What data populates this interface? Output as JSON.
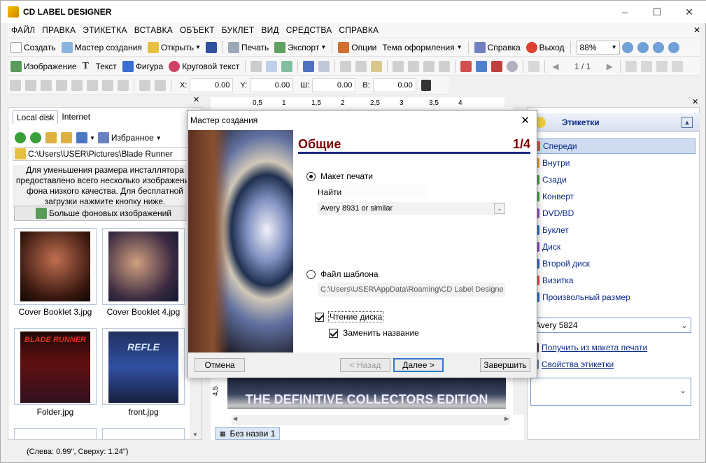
{
  "window": {
    "title": "CD LABEL DESIGNER",
    "minimize": "–",
    "maximize": "☐",
    "close": "✕"
  },
  "menu": [
    "ФАЙЛ",
    "ПРАВКА",
    "ЭТИКЕТКА",
    "ВСТАВКА",
    "ОБЪЕКТ",
    "БУКЛЕТ",
    "ВИД",
    "СРЕДСТВА",
    "СПРАВКА"
  ],
  "toolbar1": {
    "create": "Создать",
    "wizard": "Мастер создания",
    "open": "Открыть",
    "print": "Печать",
    "export": "Экспорт",
    "options": "Опции",
    "theme": "Тема оформления",
    "help": "Справка",
    "exit": "Выход",
    "zoom": "88%"
  },
  "toolbar2": {
    "image": "Изображение",
    "text": "Текст",
    "shape": "Фигура",
    "circular_text": "Круговой текст",
    "page": "1 / 1"
  },
  "toolbar3": {
    "x_label": "X:",
    "x": "0.00",
    "y_label": "Y:",
    "y": "0.00",
    "w_label": "Ш:",
    "w": "0.00",
    "h_label": "В:",
    "h": "0.00"
  },
  "left_panel": {
    "tabs": [
      "Local disk",
      "Internet"
    ],
    "favorites": "Избранное",
    "path": "C:\\Users\\USER\\Pictures\\Blade Runner",
    "info": "Для уменьшения размера инсталлятора предоставлено всего несколько изображений фона низкого качества. Для бесплатной загрузки нажмите кнопку ниже.",
    "more_button": "Больше фоновых изображений",
    "thumbs": [
      {
        "caption": "Cover Booklet 3.jpg",
        "art": ""
      },
      {
        "caption": "Cover Booklet 4.jpg",
        "art": ""
      },
      {
        "caption": "Folder.jpg",
        "art": "BLADE RUNNER"
      },
      {
        "caption": "front.jpg",
        "art": "REFLE"
      }
    ]
  },
  "canvas": {
    "ruler_marks": [
      "0,5",
      "1",
      "1,5",
      "2",
      "2,5",
      "3",
      "3,5",
      "4"
    ],
    "vertical_ruler": "4,5",
    "banner": "THE DEFINITIVE COLLECTORS EDITION",
    "doc_tab": "Без назви 1"
  },
  "right_panel": {
    "header": "Этикетки",
    "items": [
      {
        "label": "Спереди",
        "color": "#e05050"
      },
      {
        "label": "Внутри",
        "color": "#e0a030"
      },
      {
        "label": "Сзади",
        "color": "#40a040"
      },
      {
        "label": "Конверт",
        "color": "#40a040"
      },
      {
        "label": "DVD/BD",
        "color": "#9050c0"
      },
      {
        "label": "Буклет",
        "color": "#3070c0"
      },
      {
        "label": "Диск",
        "color": "#9050c0"
      },
      {
        "label": "Второй диск",
        "color": "#3070c0"
      },
      {
        "label": "Визитка",
        "color": "#e05050"
      },
      {
        "label": "Произвольный размер",
        "color": "#3070c0"
      }
    ],
    "format_select": "Avery 5824",
    "get_from_layout": "Получить из макета печати",
    "label_props": "Свойства этикетки"
  },
  "status": "(Слева: 0.99\", Сверху: 1.24\")",
  "dialog": {
    "title": "Мастер создания",
    "heading": "Общие",
    "step": "1/4",
    "radio_layout": "Макет печати",
    "search_label": "Найти",
    "layout_select": "Avery 8931 or similar",
    "radio_template": "Файл шаблона",
    "template_path": "C:\\Users\\USER\\AppData\\Roaming\\CD Label Designe",
    "check_read_disc": "Чтение диска",
    "check_replace_name": "Заменить название",
    "btn_cancel": "Отмена",
    "btn_back": "< Назад",
    "btn_next": "Далее >",
    "btn_finish": "Завершить",
    "accent": "#7a0000"
  }
}
